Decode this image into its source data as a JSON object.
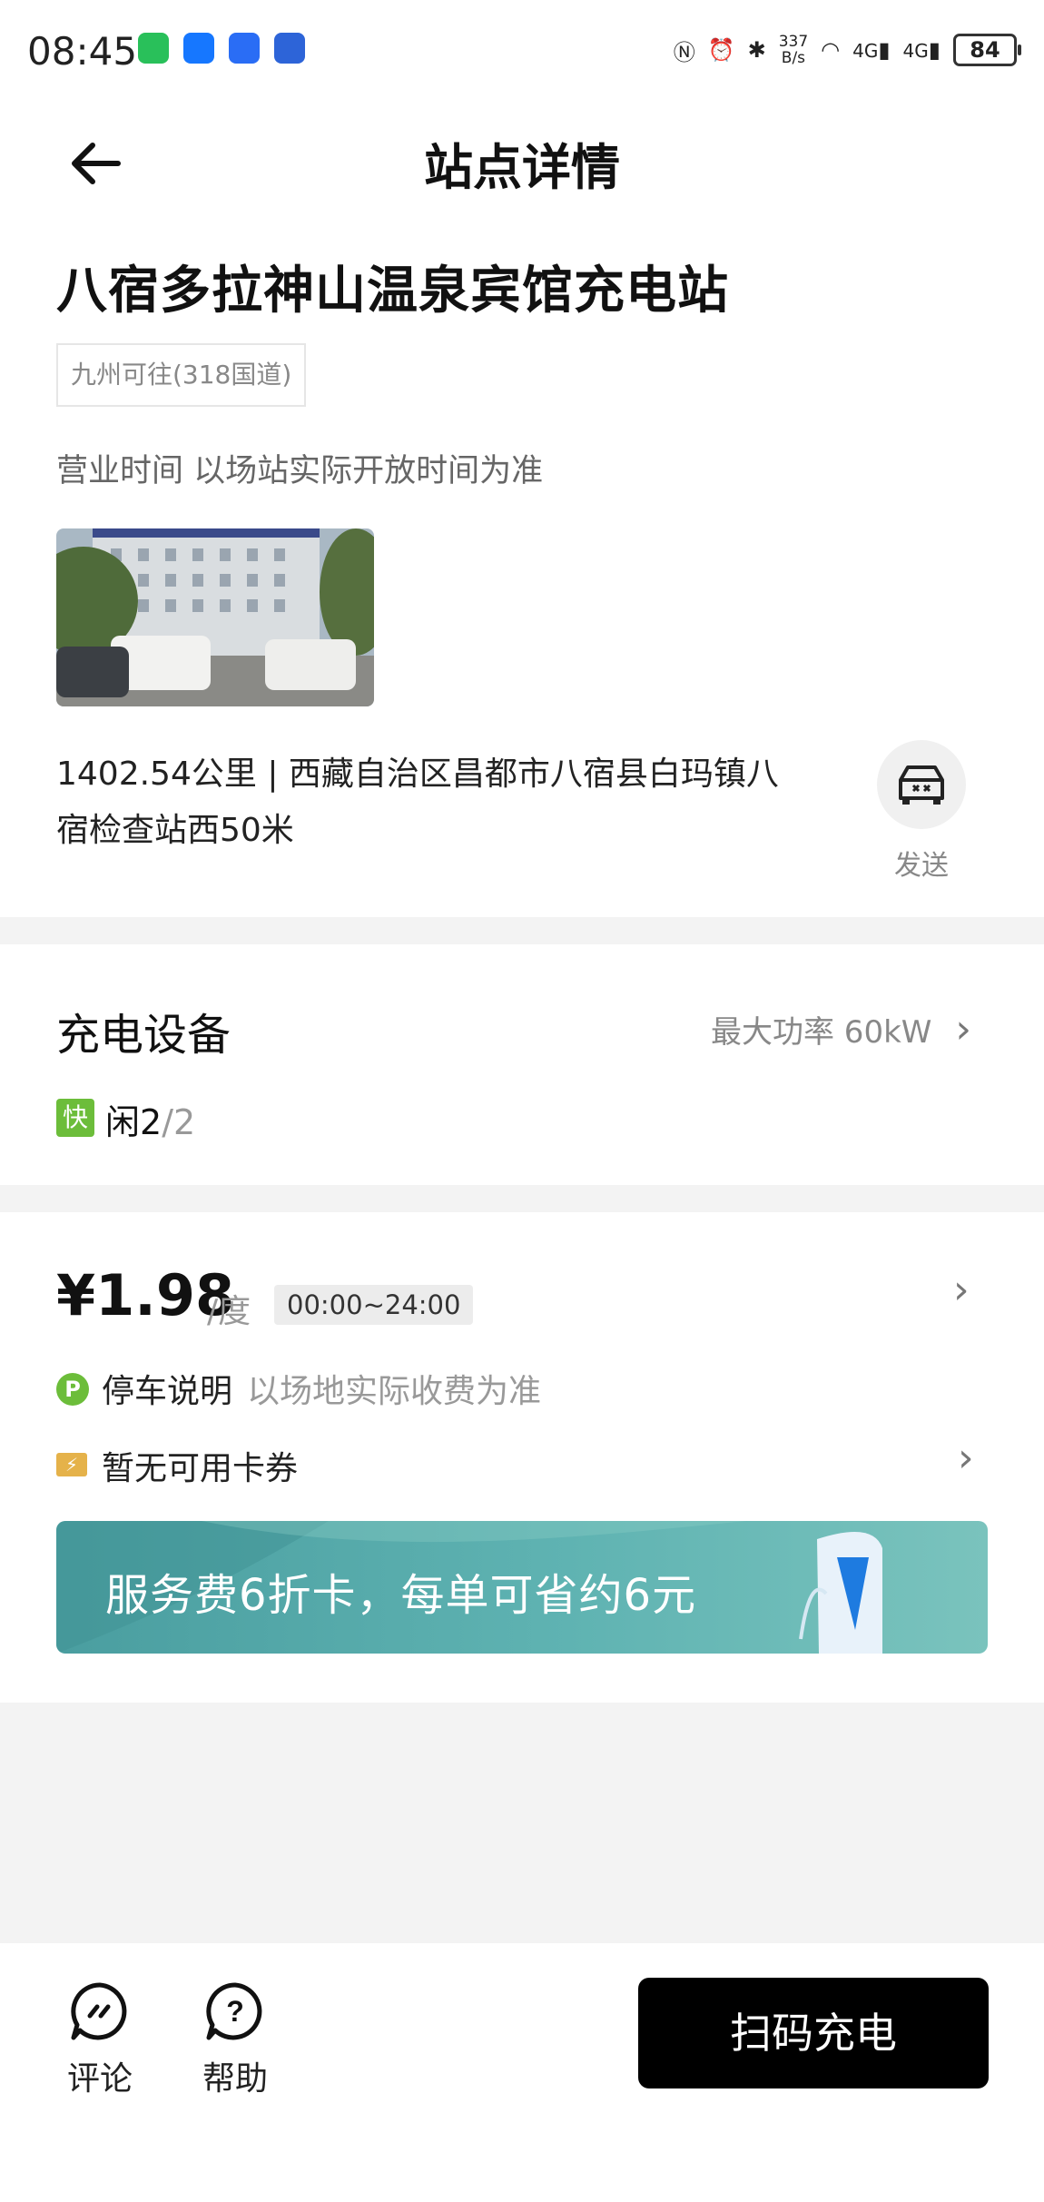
{
  "status_bar": {
    "time": "08:45",
    "net_speed_value": "337",
    "net_speed_unit": "B/s",
    "battery": "84",
    "signal_1": "4G",
    "signal_2": "4G"
  },
  "header": {
    "title": "站点详情"
  },
  "station": {
    "name": "八宿多拉神山温泉宾馆充电站",
    "tag": "九州可往(318国道)",
    "hours": "营业时间 以场站实际开放时间为准",
    "address_line1": "1402.54公里 | 西藏自治区昌都市八宿县白玛镇八",
    "address_line2": "宿检查站西50米",
    "send_label": "发送"
  },
  "equipment": {
    "title": "充电设备",
    "max_power": "最大功率 60kW",
    "fast_badge": "快",
    "idle_label": "闲2",
    "total": "/2"
  },
  "pricing": {
    "price": "¥1.98",
    "unit": "/度",
    "period": "00:00~24:00",
    "parking_icon": "P",
    "parking_label": "停车说明",
    "parking_note": "以场地实际收费为准",
    "coupon_label": "暂无可用卡券",
    "banner_text": "服务费6折卡，每单可省约6元"
  },
  "bottom": {
    "review_label": "评论",
    "help_label": "帮助",
    "scan_button": "扫码充电"
  }
}
